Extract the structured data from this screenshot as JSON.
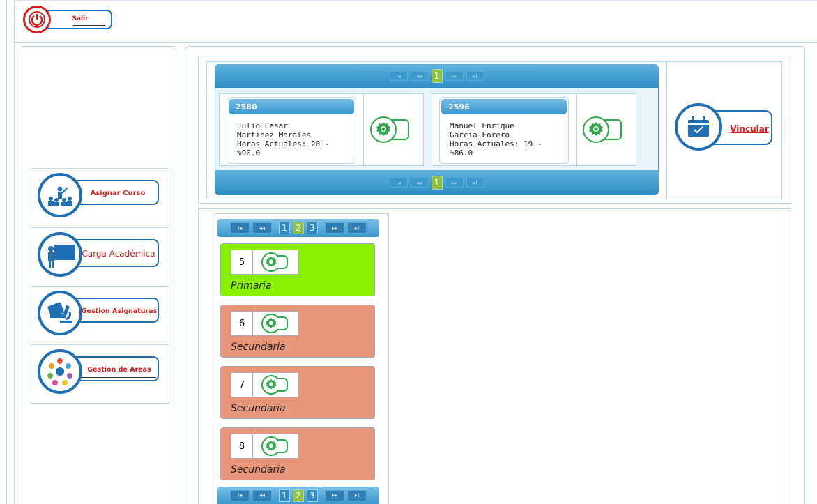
{
  "header": {
    "logout_label": "Salir"
  },
  "menu": {
    "items": [
      {
        "label": "Asignar Curso"
      },
      {
        "label": "Carga Académica"
      },
      {
        "label": "Gestion Asignaturas"
      },
      {
        "label": "Gestion de Areas"
      }
    ]
  },
  "teachers": {
    "pager": {
      "first": "I◂",
      "prev": "◂◂",
      "page": "1",
      "next": "▸▸",
      "last": "▸I"
    },
    "cards": [
      {
        "code": "2580",
        "first_name": "Julio Cesar",
        "last_name": "Martinez Morales",
        "hours": "Horas Actuales: 20 -",
        "percent": "%90.0"
      },
      {
        "code": "2596",
        "first_name": "Manuel Enrique",
        "last_name": "Garcia Forero",
        "hours": "Horas Actuales: 19 -",
        "percent": "%86.0"
      }
    ]
  },
  "link_button": {
    "label": "Vincular"
  },
  "grades": {
    "pager": {
      "first": "I◂",
      "prev": "◂◂",
      "pages": [
        "1",
        "2",
        "3"
      ],
      "active_page": "2",
      "next": "▸▸",
      "last": "▸I"
    },
    "items": [
      {
        "number": "5",
        "level": "Primaria",
        "color": "#88f000"
      },
      {
        "number": "6",
        "level": "Secundaria",
        "color": "#e8967a"
      },
      {
        "number": "7",
        "level": "Secundaria",
        "color": "#e8967a"
      },
      {
        "number": "8",
        "level": "Secundaria",
        "color": "#e8967a"
      }
    ]
  },
  "colors": {
    "accent": "#1f6fb5",
    "link_red": "#d62020",
    "pager_blue": "#3a97cf",
    "active_page": "#8fc23e",
    "gear_green": "#2ea84a"
  }
}
